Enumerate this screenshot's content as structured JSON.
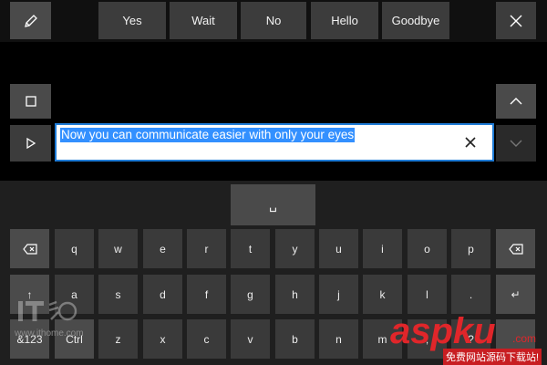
{
  "app": "Eye Control keyboard",
  "quick_phrases": [
    "Yes",
    "Wait",
    "No",
    "Hello",
    "Goodbye"
  ],
  "text_field": {
    "value": "Now you can communicate easier with only your eyes"
  },
  "space_key_glyph": "␣",
  "keyboard": {
    "row1": [
      "q",
      "w",
      "e",
      "r",
      "t",
      "y",
      "u",
      "i",
      "o",
      "p"
    ],
    "row2": [
      "a",
      "s",
      "d",
      "f",
      "g",
      "h",
      "j",
      "k",
      "l",
      "."
    ],
    "row3": [
      "z",
      "x",
      "c",
      "v",
      "b",
      "n",
      "m",
      ",",
      "?"
    ],
    "symbols_label": "&123",
    "ctrl_label": "Ctrl",
    "shift_glyph": "↑",
    "enter_glyph": "↵"
  },
  "watermarks": {
    "left_url": "www.ithome.com",
    "right_brand": "aspku",
    "right_suffix": ".com",
    "right_tagline": "免费网站源码下载站!"
  },
  "colors": {
    "accent": "#1e7bd6",
    "selection": "#3390ff",
    "watermark_red": "#e0262a"
  }
}
